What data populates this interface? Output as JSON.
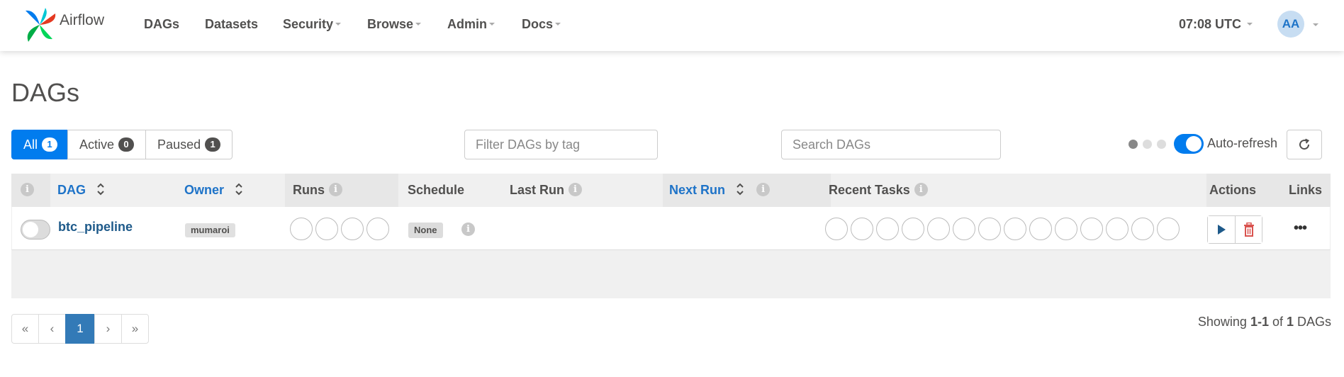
{
  "brand": {
    "name": "Airflow"
  },
  "nav": {
    "items": [
      {
        "label": "DAGs",
        "dropdown": false
      },
      {
        "label": "Datasets",
        "dropdown": false
      },
      {
        "label": "Security",
        "dropdown": true
      },
      {
        "label": "Browse",
        "dropdown": true
      },
      {
        "label": "Admin",
        "dropdown": true
      },
      {
        "label": "Docs",
        "dropdown": true
      }
    ],
    "time": "07:08 UTC",
    "user_initials": "AA"
  },
  "page": {
    "title": "DAGs"
  },
  "filters": {
    "status": [
      {
        "label": "All",
        "count": "1",
        "active": true
      },
      {
        "label": "Active",
        "count": "0",
        "active": false
      },
      {
        "label": "Paused",
        "count": "1",
        "active": false
      }
    ],
    "tag_placeholder": "Filter DAGs by tag",
    "search_placeholder": "Search DAGs",
    "auto_refresh_label": "Auto-refresh",
    "auto_refresh_on": true
  },
  "table": {
    "headers": {
      "dag": "DAG",
      "owner": "Owner",
      "runs": "Runs",
      "schedule": "Schedule",
      "last_run": "Last Run",
      "next_run": "Next Run",
      "recent_tasks": "Recent Tasks",
      "actions": "Actions",
      "links": "Links"
    },
    "rows": [
      {
        "dag_id": "btc_pipeline",
        "paused": true,
        "owner": "mumaroi",
        "schedule": "None",
        "last_run": "",
        "next_run": ""
      }
    ]
  },
  "pagination": {
    "first": "«",
    "prev": "‹",
    "current": "1",
    "next": "›",
    "last": "»",
    "showing_prefix": "Showing ",
    "showing_range": "1-1",
    "showing_of": " of ",
    "showing_total": "1",
    "showing_suffix": " DAGs"
  },
  "colors": {
    "accent": "#017cee",
    "text": "#51504f",
    "link": "#1e5a8a",
    "danger": "#d9534f"
  }
}
